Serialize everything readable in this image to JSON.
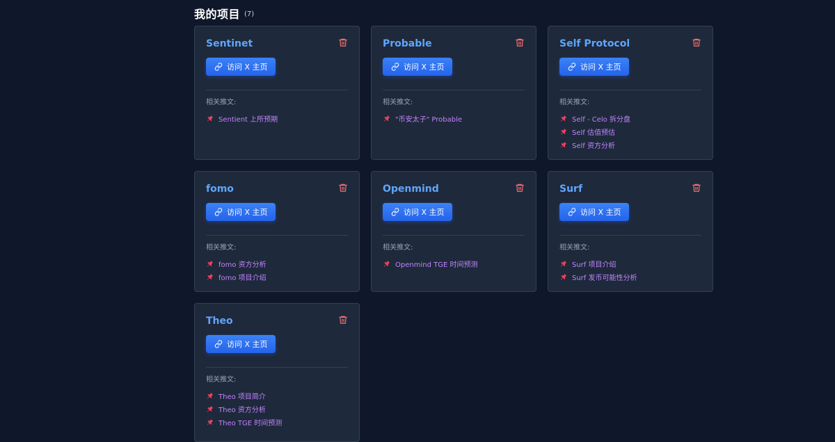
{
  "header": {
    "title": "我的项目",
    "count": "(7)"
  },
  "common": {
    "visit_label": "访问 X 主页",
    "related_label": "相关推文:"
  },
  "projects": [
    {
      "name": "Sentinet",
      "posts": [
        "Sentient 上所预期"
      ]
    },
    {
      "name": "Probable",
      "posts": [
        "\"币安太子\" Probable"
      ]
    },
    {
      "name": "Self Protocol",
      "posts": [
        "Self - Celo 拆分盘",
        "Self 估值预估",
        "Self 资方分析"
      ]
    },
    {
      "name": "fomo",
      "posts": [
        "fomo 资方分析",
        "fomo 项目介绍"
      ]
    },
    {
      "name": "Openmind",
      "posts": [
        "Openmind TGE 时间预测"
      ]
    },
    {
      "name": "Surf",
      "posts": [
        "Surf 项目介绍",
        "Surf 发币可能性分析"
      ]
    },
    {
      "name": "Theo",
      "posts": [
        "Theo 项目简介",
        "Theo 资方分析",
        "Theo TGE 时间预测"
      ]
    }
  ],
  "colors": {
    "background": "#0f172a",
    "card": "#1e293b",
    "accent": "#60a5fa",
    "button": "#3b82f6",
    "delete": "#f87171",
    "post_text": "#c084fc",
    "pin": "#f43f5e"
  },
  "icons": {
    "delete": "trash-icon",
    "visit": "link-icon",
    "post": "pin-icon"
  }
}
